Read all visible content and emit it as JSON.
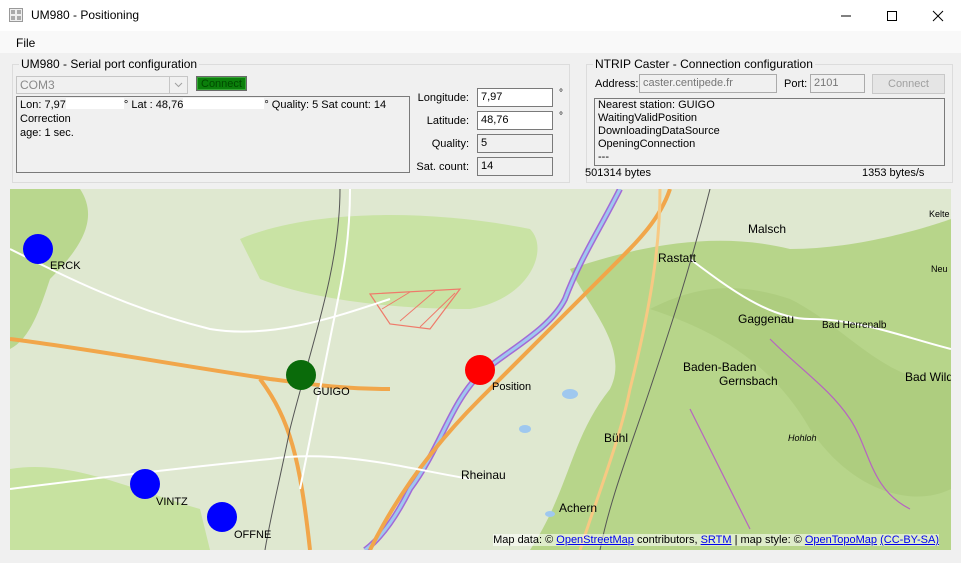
{
  "window": {
    "title": "UM980 - Positioning",
    "minimize": "─",
    "maximize": "☐",
    "close": "✕"
  },
  "menu": {
    "file": "File"
  },
  "serial": {
    "group_title": "UM980 - Serial port configuration",
    "port": "COM3",
    "connect_label": "Connect",
    "output": {
      "lon_prefix": "Lon: 7,97",
      "lat_prefix": "° Lat : 48,76",
      "quality_line": "° Quality: 5 Sat count: 14 Correction",
      "age_line": "age: 1 sec."
    }
  },
  "fields": {
    "longitude_label": "Longitude:",
    "longitude_value": "7,97",
    "latitude_label": "Latitude:",
    "latitude_value": "48,76",
    "quality_label": "Quality:",
    "quality_value": "5",
    "satcount_label": "Sat. count:",
    "satcount_value": "14",
    "deg_symbol": "°"
  },
  "caster": {
    "group_title": "NTRIP Caster - Connection configuration",
    "address_label": "Address:",
    "address_value": "caster.centipede.fr",
    "port_label": "Port:",
    "port_value": "2101",
    "connect_label": "Connect",
    "log": [
      "Nearest station: GUIGO",
      "WaitingValidPosition",
      "DownloadingDataSource",
      "OpeningConnection",
      "---"
    ],
    "bytes_received": "501314 bytes",
    "rate": "1353 bytes/s"
  },
  "map": {
    "attribution": {
      "prefix": "Map data: ©",
      "osm": "OpenStreetMap",
      "middle": "contributors,",
      "srtm": "SRTM",
      "style": "| map style: ©",
      "otm": "OpenTopoMap",
      "license": "(CC-BY-SA)"
    },
    "stations": [
      {
        "name": "ERCK",
        "color": "#0000ff"
      },
      {
        "name": "GUIGO",
        "color": "#0a6b0a"
      },
      {
        "name": "Position",
        "color": "#ff0000"
      },
      {
        "name": "VINTZ",
        "color": "#0000ff"
      },
      {
        "name": "OFFNE",
        "color": "#0000ff"
      }
    ],
    "places": [
      "Malsch",
      "Rastatt",
      "Gaggenau",
      "Bad Herrenalb",
      "Baden-Baden",
      "Gernsbach",
      "Bad Wild",
      "Hohloh",
      "Bühl",
      "Rheinau",
      "Achern",
      "Kelte",
      "Neu"
    ],
    "colors": {
      "base": "#dfe8d0",
      "forest": "#c2dd9a",
      "road": "#f1a64a",
      "river": "#9b5cd8",
      "water": "#9fc8ef"
    }
  }
}
